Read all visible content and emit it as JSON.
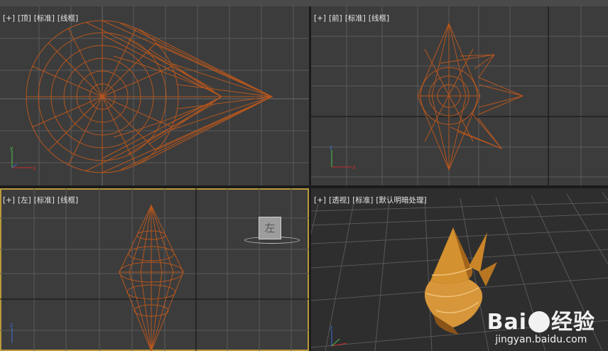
{
  "viewports": {
    "top": {
      "labels": [
        "[+]",
        "[顶]",
        "[标准]",
        "[线框]"
      ]
    },
    "front": {
      "labels": [
        "[+]",
        "[前]",
        "[标准]",
        "[线框]"
      ]
    },
    "left": {
      "labels": [
        "[+]",
        "[左]",
        "[标准]",
        "[线框]"
      ],
      "viewcube_face": "左"
    },
    "persp": {
      "labels": [
        "[+]",
        "[透视]",
        "[标准]",
        "[默认明暗处理]"
      ]
    }
  },
  "axes": {
    "x": "x",
    "y": "y",
    "z": "z"
  },
  "colors": {
    "wire": "#b5561e",
    "shaded": "#d4912f",
    "grid": "#5a5a5a",
    "grid_major": "#111111",
    "axis_x": "#c62a2a",
    "axis_y": "#4fbf4f",
    "axis_z": "#3b6fd8"
  },
  "watermark": {
    "brand_left": "Bai",
    "brand_right": "经验",
    "url": "jingyan.baidu.com"
  }
}
